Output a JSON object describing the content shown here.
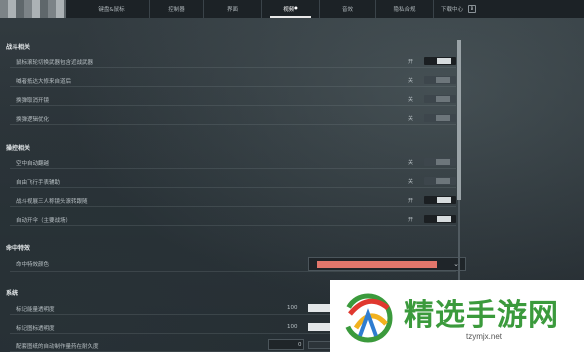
{
  "tabs": [
    {
      "label": "键盘&鼠标",
      "active": false
    },
    {
      "label": "控制器",
      "active": false
    },
    {
      "label": "界面",
      "active": false
    },
    {
      "label": "视频",
      "active": true,
      "marker": "●"
    },
    {
      "label": "音效",
      "active": false
    },
    {
      "label": "隐私合规",
      "active": false
    },
    {
      "label": "下载中心",
      "active": false
    }
  ],
  "tab_end_icon": "B",
  "sections": {
    "combat": {
      "title": "战斗相关",
      "rows": [
        {
          "label": "鼠标滚轮切换武器包含近战武器",
          "state": "开",
          "on": true
        },
        {
          "label": "喊者抵达大修来自道后",
          "state": "关",
          "on": false
        },
        {
          "label": "换弹取消开镜",
          "state": "关",
          "on": false
        },
        {
          "label": "换弹逻辑优化",
          "state": "关",
          "on": false
        }
      ]
    },
    "control": {
      "title": "操控相关",
      "rows": [
        {
          "label": "空中自动翻越",
          "state": "关",
          "on": false
        },
        {
          "label": "自由飞行手表辅助",
          "state": "关",
          "on": false
        },
        {
          "label": "战斗视展三人称镜头滚转跟随",
          "state": "开",
          "on": true
        },
        {
          "label": "自动开伞（主要战场）",
          "state": "开",
          "on": true
        }
      ]
    },
    "hit": {
      "title": "命中特效",
      "rows": [
        {
          "label": "命中特效颜色",
          "color": "#e2766b",
          "chevron": "⌄"
        }
      ]
    },
    "system": {
      "title": "系统",
      "rows": [
        {
          "label": "标记能量透明度",
          "value": "100"
        },
        {
          "label": "标记图标透明度",
          "value": "100"
        },
        {
          "label": "配套图纸的自动制作量药在耐久度",
          "value": "0"
        }
      ]
    }
  },
  "watermark": {
    "text": "精选手游网",
    "url": "tzymjx.net"
  },
  "colors": {
    "accent_color_swatch": "#e2766b",
    "watermark_green": "#3b9a3c"
  }
}
